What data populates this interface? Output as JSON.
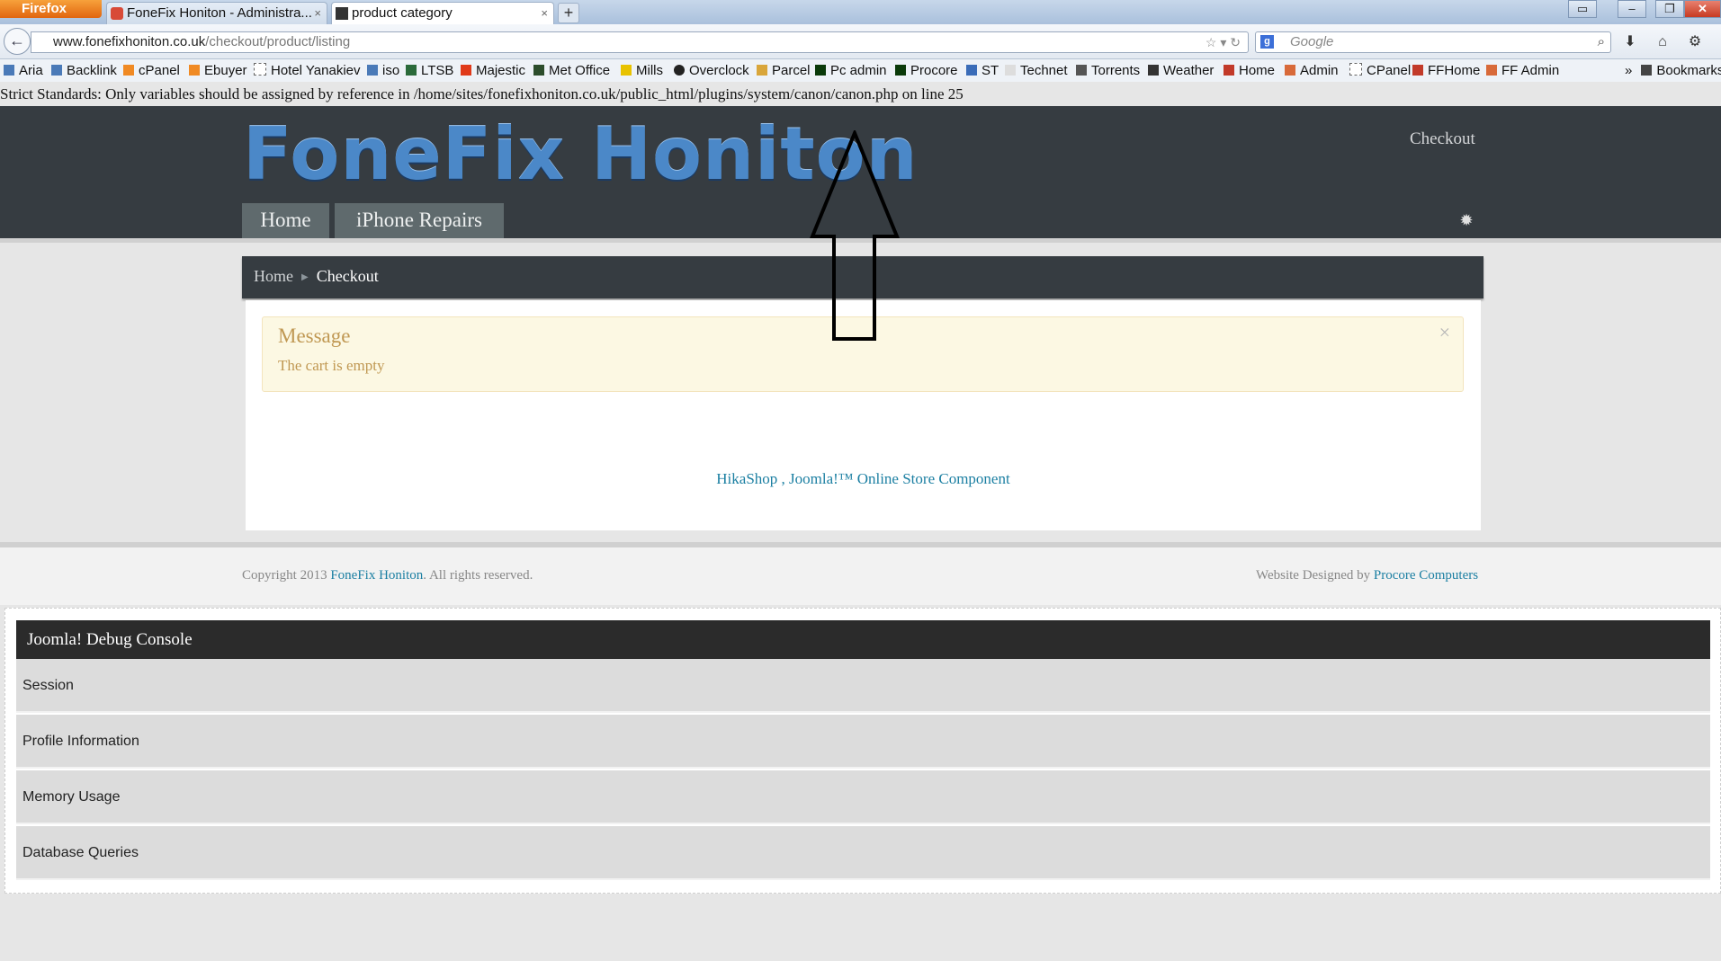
{
  "browser": {
    "app_button": "Firefox",
    "tabs": [
      {
        "title": "FoneFix Honiton - Administra...",
        "active": false
      },
      {
        "title": "product category",
        "active": true
      }
    ],
    "new_tab": "+",
    "url_host": "www.fonefixhoniton.co.uk",
    "url_path": "/checkout/product/listing",
    "search_placeholder": "Google"
  },
  "bookmarks": [
    "Aria",
    "Backlink",
    "cPanel",
    "Ebuyer",
    "Hotel Yanakiev",
    "iso",
    "LTSB",
    "Majestic",
    "Met Office",
    "Mills",
    "Overclock",
    "Parcel",
    "Pc admin",
    "Procore",
    "ST",
    "Technet",
    "Torrents",
    "Weather",
    "Home",
    "Admin",
    "CPanel",
    "FFHome",
    "FF Admin",
    "Bookmarks"
  ],
  "php_warning": "Strict Standards: Only variables should be assigned by reference in /home/sites/fonefixhoniton.co.uk/public_html/plugins/system/canon/canon.php on line 25",
  "site": {
    "logo": "FoneFix Honiton",
    "header_link": "Checkout",
    "menu": [
      "Home",
      "iPhone Repairs"
    ],
    "breadcrumb": {
      "home": "Home",
      "current": "Checkout"
    },
    "message": {
      "title": "Message",
      "body": "The cart is empty",
      "close": "×"
    },
    "powered_by": "HikaShop , Joomla!™ Online Store Component",
    "footer": {
      "copyright_prefix": "Copyright 2013 ",
      "copyright_link": "FoneFix Honiton",
      "copyright_suffix": ". All rights reserved.",
      "designed_prefix": "Website Designed by ",
      "designed_link": "Procore Computers"
    }
  },
  "debug": {
    "title": "Joomla! Debug Console",
    "rows": [
      "Session",
      "Profile Information",
      "Memory Usage",
      "Database Queries"
    ]
  },
  "colors": {
    "header_bg": "#363c41",
    "link": "#1b7fa2",
    "message_bg": "#fcf8e3",
    "message_text": "#c09853"
  }
}
